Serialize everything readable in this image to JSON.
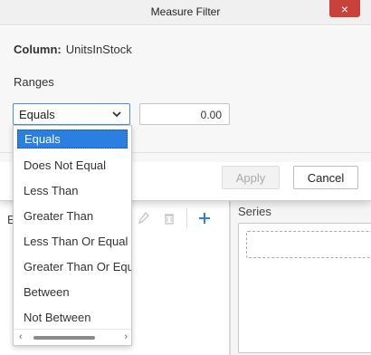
{
  "dialog": {
    "title": "Measure Filter",
    "close_glyph": "×",
    "column_label": "Column:",
    "column_value": "UnitsInStock",
    "ranges_label": "Ranges",
    "selected_condition": "Equals",
    "value": "0.00",
    "apply_label": "Apply",
    "cancel_label": "Cancel"
  },
  "dropdown": {
    "items": [
      "Equals",
      "Does Not Equal",
      "Less Than",
      "Greater Than",
      "Less Than Or Equal To",
      "Greater Than Or Equal To",
      "Between",
      "Not Between"
    ],
    "scroll_left": "‹",
    "scroll_right": "›"
  },
  "background": {
    "toolbar_label": "E",
    "series_label": "Series",
    "icons": [
      "edit-icon",
      "delete-icon",
      "add-icon"
    ]
  },
  "colors": {
    "accent": "#2a7fe0",
    "close": "#c8423b",
    "add_icon": "#2a7fe0"
  }
}
